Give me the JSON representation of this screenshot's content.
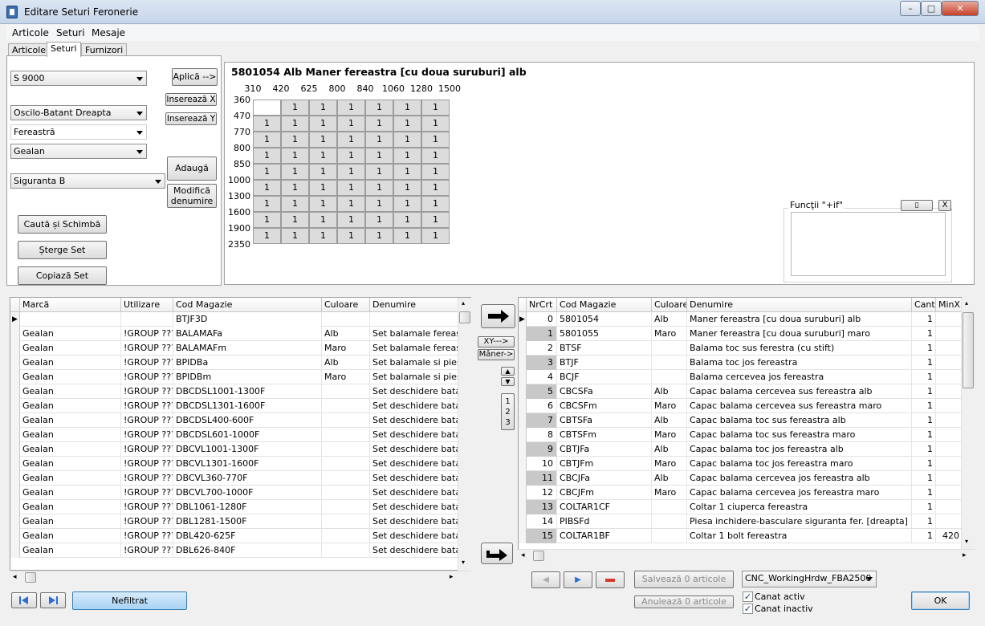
{
  "window": {
    "title": "Editare Seturi Feronerie",
    "min": "▭",
    "max": "□",
    "close": "✕"
  },
  "menu": [
    "Articole",
    "Seturi",
    "Mesaje"
  ],
  "tabs": [
    "Articole",
    "Seturi",
    "Furnizori"
  ],
  "left": {
    "set_select": "S 9000",
    "type_select": "Oscilo-Batant Dreapta",
    "category_select": "Fereastră",
    "brand_select": "Gealan",
    "safety_select": "Siguranta B",
    "apply_btn": "Aplică -->",
    "insert_x_btn": "Inserează X",
    "insert_y_btn": "Inserează Y",
    "add_set_btn": "Adaugă Set",
    "rename_btn_line1": "Modifică",
    "rename_btn_line2": "denumire",
    "search_replace_btn": "Caută și Schimbă",
    "delete_set_btn": "Șterge Set",
    "copy_set_btn": "Copiază Set"
  },
  "grid": {
    "header": "5801054  Alb  Maner fereastra [cu doua suruburi] alb",
    "cols": [
      "310",
      "420",
      "625",
      "800",
      "840",
      "1060",
      "1280",
      "1500"
    ],
    "rows": [
      "360",
      "470",
      "770",
      "800",
      "850",
      "1000",
      "1300",
      "1600",
      "1900",
      "2350"
    ],
    "cell_value": "1"
  },
  "functions": {
    "label": "Funcţii \"+if\"",
    "btn_expand": "▯",
    "btn_close": "X"
  },
  "articles_table": {
    "headers": [
      "Marcă",
      "Utilizare",
      "Cod Magazie",
      "Culoare",
      "Denumire"
    ],
    "rows": [
      [
        "",
        "",
        "BTJF3D",
        "",
        ""
      ],
      [
        "Gealan",
        "!GROUP ???",
        "BALAMAFa",
        "Alb",
        "Set balamale fereastra"
      ],
      [
        "Gealan",
        "!GROUP ???",
        "BALAMAFm",
        "Maro",
        "Set balamale fereastra"
      ],
      [
        "Gealan",
        "!GROUP ???",
        "BPIDBa",
        "Alb",
        "Set balamale si piese de"
      ],
      [
        "Gealan",
        "!GROUP ???",
        "BPIDBm",
        "Maro",
        "Set balamale si piese de"
      ],
      [
        "Gealan",
        "!GROUP ???",
        "DBCDSL1001-1300F",
        "",
        "Set deschidere batant"
      ],
      [
        "Gealan",
        "!GROUP ???",
        "DBCDSL1301-1600F",
        "",
        "Set deschidere batant"
      ],
      [
        "Gealan",
        "!GROUP ???",
        "DBCDSL400-600F",
        "",
        "Set deschidere batant"
      ],
      [
        "Gealan",
        "!GROUP ???",
        "DBCDSL601-1000F",
        "",
        "Set deschidere batant"
      ],
      [
        "Gealan",
        "!GROUP ???",
        "DBCVL1001-1300F",
        "",
        "Set deschidere batant"
      ],
      [
        "Gealan",
        "!GROUP ???",
        "DBCVL1301-1600F",
        "",
        "Set deschidere batant"
      ],
      [
        "Gealan",
        "!GROUP ???",
        "DBCVL360-770F",
        "",
        "Set deschidere batant"
      ],
      [
        "Gealan",
        "!GROUP ???",
        "DBCVL700-1000F",
        "",
        "Set deschidere batant"
      ],
      [
        "Gealan",
        "!GROUP ???",
        "DBL1061-1280F",
        "",
        "Set deschidere batant"
      ],
      [
        "Gealan",
        "!GROUP ???",
        "DBL1281-1500F",
        "",
        "Set deschidere batant"
      ],
      [
        "Gealan",
        "!GROUP ???",
        "DBL420-625F",
        "",
        "Set deschidere batant"
      ],
      [
        "Gealan",
        "!GROUP ???",
        "DBL626-840F",
        "",
        "Set deschidere batant"
      ]
    ]
  },
  "middle": {
    "xy_btn": "XY--->",
    "maner_btn": "Mâner->",
    "order_digits": [
      "1",
      "2",
      "3"
    ]
  },
  "set_table": {
    "headers": [
      "NrCrt",
      "Cod Magazie",
      "Culoare",
      "Denumire",
      "Cant",
      "MinX"
    ],
    "rows": [
      [
        "0",
        "5801054",
        "Alb",
        "Maner fereastra [cu doua suruburi] alb",
        "1",
        ""
      ],
      [
        "1",
        "5801055",
        "Maro",
        "Maner fereastra [cu doua suruburi] maro",
        "1",
        ""
      ],
      [
        "2",
        "BTSF",
        "",
        "Balama toc sus ferestra (cu stift)",
        "1",
        ""
      ],
      [
        "3",
        "BTJF",
        "",
        "Balama toc jos fereastra",
        "1",
        ""
      ],
      [
        "4",
        "BCJF",
        "",
        "Balama cercevea jos fereastra",
        "1",
        ""
      ],
      [
        "5",
        "CBCSFa",
        "Alb",
        "Capac balama cercevea sus fereastra alb",
        "1",
        ""
      ],
      [
        "6",
        "CBCSFm",
        "Maro",
        "Capac balama cercevea sus fereastra maro",
        "1",
        ""
      ],
      [
        "7",
        "CBTSFa",
        "Alb",
        "Capac balama toc sus fereastra alb",
        "1",
        ""
      ],
      [
        "8",
        "CBTSFm",
        "Maro",
        "Capac balama toc sus fereastra maro",
        "1",
        ""
      ],
      [
        "9",
        "CBTJFa",
        "Alb",
        "Capac balama toc jos fereastra alb",
        "1",
        ""
      ],
      [
        "10",
        "CBTJFm",
        "Maro",
        "Capac balama toc jos fereastra maro",
        "1",
        ""
      ],
      [
        "11",
        "CBCJFa",
        "Alb",
        "Capac balama cercevea jos fereastra alb",
        "1",
        ""
      ],
      [
        "12",
        "CBCJFm",
        "Maro",
        "Capac balama cercevea jos fereastra maro",
        "1",
        ""
      ],
      [
        "13",
        "COLTAR1CF",
        "",
        "Coltar 1 ciuperca fereastra",
        "1",
        ""
      ],
      [
        "14",
        "PIBSFd",
        "",
        "Piesa inchidere-basculare siguranta fer. [dreapta]",
        "1",
        ""
      ],
      [
        "15",
        "COLTAR1BF",
        "",
        "Coltar 1 bolt fereastra",
        "1",
        "420"
      ]
    ]
  },
  "bottom": {
    "filter_btn": "Nefiltrat",
    "save_btn": "Salvează 0 articole",
    "cancel_btn": "Anulează 0 articole",
    "cnc_select": "CNC_WorkingHrdw_FBA2500",
    "active_check": "Canat activ",
    "inactive_check": "Canat inactiv",
    "ok_btn": "OK"
  },
  "colors": {
    "accent_blue": "#2f6bd6",
    "minus_red": "#d53a2a",
    "selected_gray": "#c8c8c8"
  }
}
